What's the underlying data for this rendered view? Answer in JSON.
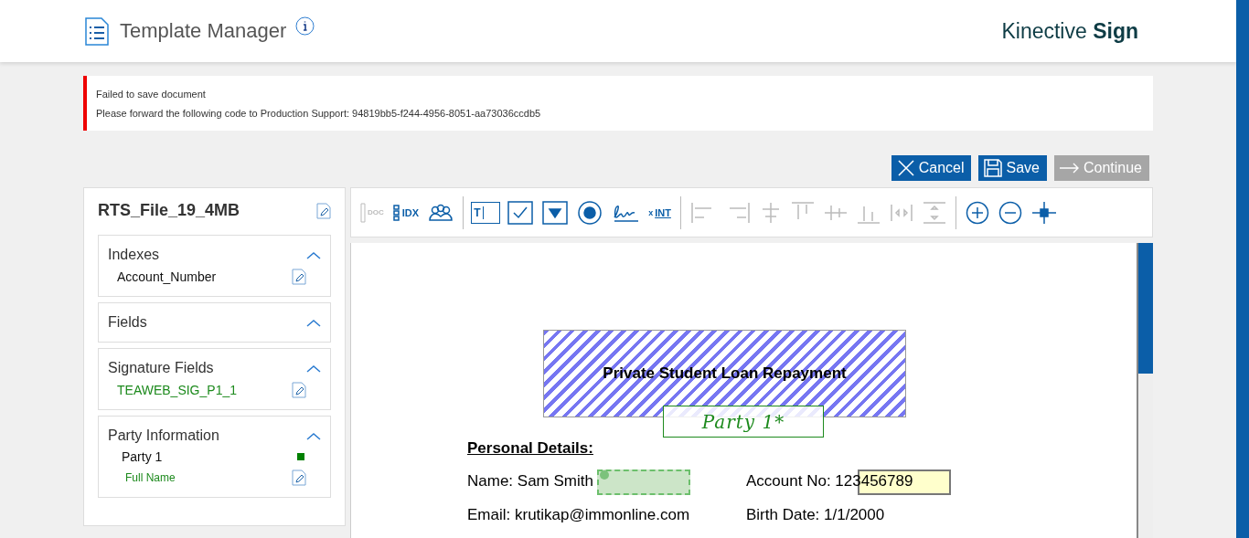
{
  "header": {
    "title": "Template Manager",
    "brand": "Kinective **Sign**"
  },
  "alert": {
    "lines": [
      "Failed to save document",
      "Please forward the following code to Production Support: 94819bb5-f244-4956-8051-aa73036ccdb5"
    ]
  },
  "actions": [
    {
      "kind": "cancel",
      "label": "Cancel",
      "disabled": false
    },
    {
      "kind": "save",
      "label": "Save",
      "disabled": false
    },
    {
      "kind": "continue",
      "label": "Continue",
      "disabled": true
    }
  ],
  "sidebar": {
    "title": "RTS_File_19_4MB",
    "sections": [
      {
        "title": "Indexes",
        "expanded": true,
        "items": [
          {
            "kind": "index",
            "label": "Account_Number"
          }
        ]
      },
      {
        "title": "Fields",
        "expanded": true
      },
      {
        "title": "Signature Fields",
        "expanded": true,
        "items": [
          {
            "kind": "signature",
            "label": "TEAWEB_SIG_P1_1"
          }
        ]
      },
      {
        "title": "Party Information",
        "expanded": true,
        "items": [
          {
            "kind": "party",
            "label": "Party 1",
            "color": "#008000"
          },
          {
            "kind": "party-field",
            "label": "Full Name"
          }
        ]
      }
    ]
  },
  "toolbar": [
    {
      "kind": "doc",
      "label": "DOC",
      "disabled": true
    },
    {
      "kind": "idx",
      "label": "IDX",
      "disabled": false
    },
    {
      "kind": "parties",
      "disabled": false
    },
    {
      "kind": "separator"
    },
    {
      "kind": "textbox",
      "label": "T",
      "disabled": false
    },
    {
      "kind": "checkbox",
      "disabled": false
    },
    {
      "kind": "dropdown",
      "disabled": false
    },
    {
      "kind": "radio",
      "disabled": false
    },
    {
      "kind": "signature",
      "disabled": false
    },
    {
      "kind": "initials",
      "prefix": "x",
      "label": "INT",
      "disabled": false
    },
    {
      "kind": "separator"
    },
    {
      "kind": "align-left",
      "disabled": true
    },
    {
      "kind": "align-right",
      "disabled": true
    },
    {
      "kind": "align-center",
      "disabled": true
    },
    {
      "kind": "align-top",
      "disabled": true
    },
    {
      "kind": "align-middle",
      "disabled": true
    },
    {
      "kind": "align-bottom",
      "disabled": true
    },
    {
      "kind": "space-h",
      "disabled": true
    },
    {
      "kind": "space-v",
      "disabled": true
    },
    {
      "kind": "separator"
    },
    {
      "kind": "zoom-in",
      "disabled": false
    },
    {
      "kind": "zoom-out",
      "disabled": false
    },
    {
      "kind": "crosshair",
      "disabled": false
    }
  ],
  "document": {
    "title": "Private Student Loan Repayment",
    "party_tag": "Party 1*",
    "heading": "Personal Details:",
    "rows": [
      [
        {
          "label": "Name:",
          "value": "Sam Smith",
          "field": {
            "kind": "text",
            "color": "#cce5c8"
          }
        },
        {
          "label": "Account No:",
          "value": "123456789",
          "field": {
            "kind": "plain",
            "color": "#ffffcc"
          }
        }
      ],
      [
        {
          "label": "Email:",
          "value": "krutikap@immonline.com"
        },
        {
          "label": "Birth Date:",
          "value": "1/1/2000"
        }
      ]
    ]
  }
}
